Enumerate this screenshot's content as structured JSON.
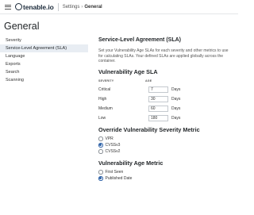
{
  "header": {
    "brand": "tenable.io",
    "breadcrumb": {
      "parent": "Settings",
      "separator": "›",
      "current": "General"
    }
  },
  "page": {
    "title": "General"
  },
  "sidebar": {
    "items": [
      {
        "label": "Severity",
        "active": false
      },
      {
        "label": "Service-Level Agreement (SLA)",
        "active": true
      },
      {
        "label": "Language",
        "active": false
      },
      {
        "label": "Exports",
        "active": false
      },
      {
        "label": "Search",
        "active": false
      },
      {
        "label": "Scanning",
        "active": false
      }
    ]
  },
  "main": {
    "section_title": "Service-Level Agreement (SLA)",
    "description": "Set your Vulnerability Age SLAs for each severity and other metrics to use for calculating SLAs. Your defined SLAs are applied globally across the container.",
    "age_sla": {
      "title": "Vulnerability Age SLA",
      "col_severity": "SEVERITY",
      "col_age": "AGE",
      "rows": [
        {
          "severity": "Critical",
          "value": "7",
          "unit": "Days"
        },
        {
          "severity": "High",
          "value": "30",
          "unit": "Days"
        },
        {
          "severity": "Medium",
          "value": "60",
          "unit": "Days"
        },
        {
          "severity": "Low",
          "value": "180",
          "unit": "Days"
        }
      ]
    },
    "override_metric": {
      "title": "Override Vulnerability Severity Metric",
      "options": [
        {
          "label": "VPR",
          "checked": false
        },
        {
          "label": "CVSSv3",
          "checked": true
        },
        {
          "label": "CVSSv2",
          "checked": false
        }
      ]
    },
    "age_metric": {
      "title": "Vulnerability Age Metric",
      "options": [
        {
          "label": "First Seen",
          "checked": false
        },
        {
          "label": "Published Date",
          "checked": true
        }
      ]
    }
  },
  "colors": {
    "accent": "#2f63a8",
    "active_nav_bg": "#e8edf3"
  }
}
